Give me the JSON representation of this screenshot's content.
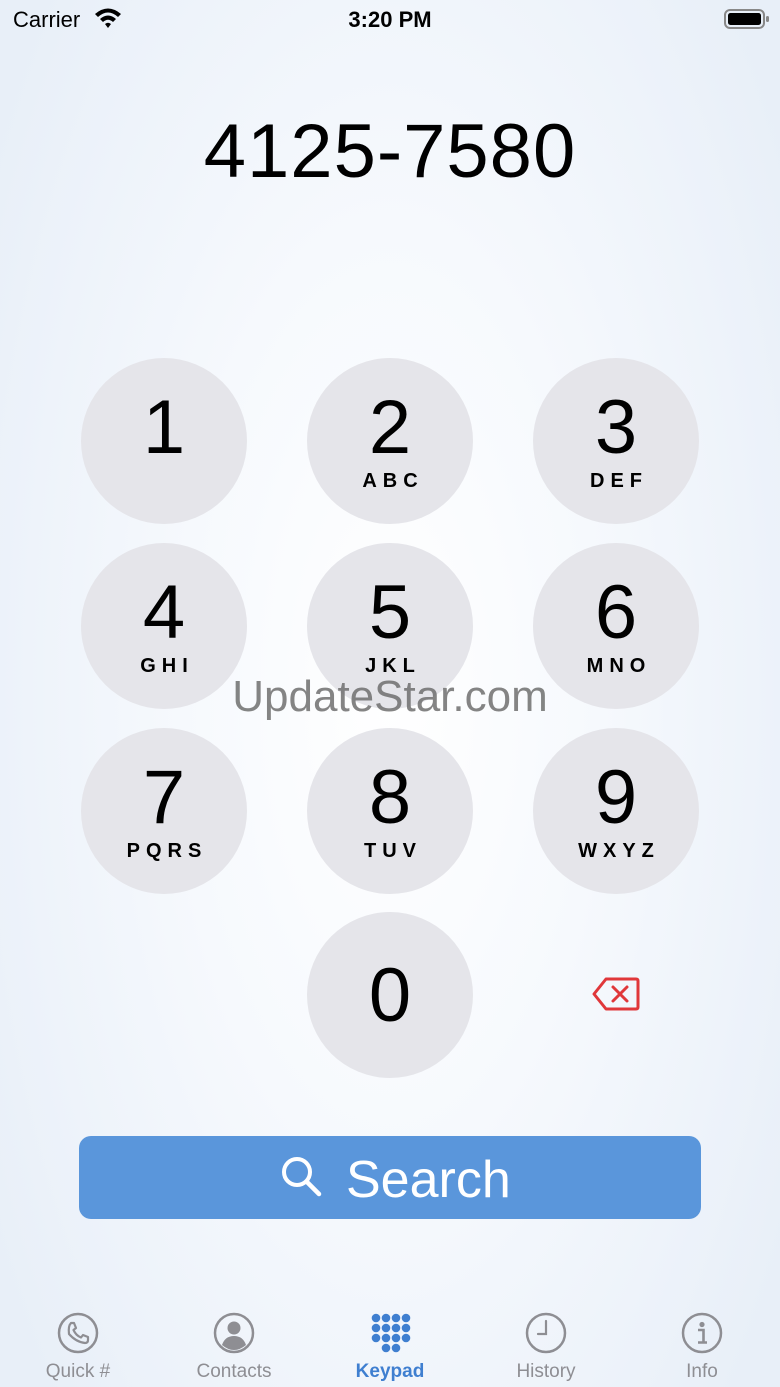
{
  "status_bar": {
    "carrier": "Carrier",
    "time": "3:20 PM"
  },
  "dialer": {
    "number": "4125-7580"
  },
  "keypad": {
    "keys": [
      {
        "digit": "1",
        "letters": ""
      },
      {
        "digit": "2",
        "letters": "ABC"
      },
      {
        "digit": "3",
        "letters": "DEF"
      },
      {
        "digit": "4",
        "letters": "GHI"
      },
      {
        "digit": "5",
        "letters": "JKL"
      },
      {
        "digit": "6",
        "letters": "MNO"
      },
      {
        "digit": "7",
        "letters": "PQRS"
      },
      {
        "digit": "8",
        "letters": "TUV"
      },
      {
        "digit": "9",
        "letters": "WXYZ"
      },
      {
        "digit": "0",
        "letters": ""
      }
    ]
  },
  "search": {
    "label": "Search"
  },
  "watermark": "UpdateStar.com",
  "tabs": [
    {
      "label": "Quick #",
      "icon": "phone-icon",
      "active": false
    },
    {
      "label": "Contacts",
      "icon": "contact-icon",
      "active": false
    },
    {
      "label": "Keypad",
      "icon": "keypad-icon",
      "active": true
    },
    {
      "label": "History",
      "icon": "clock-icon",
      "active": false
    },
    {
      "label": "Info",
      "icon": "info-icon",
      "active": false
    }
  ],
  "colors": {
    "accent": "#3f7fd0",
    "search_button": "#5a96db",
    "key_background": "#e5e5ea",
    "backspace": "#e0373a",
    "inactive_tab": "#8e8e93"
  }
}
